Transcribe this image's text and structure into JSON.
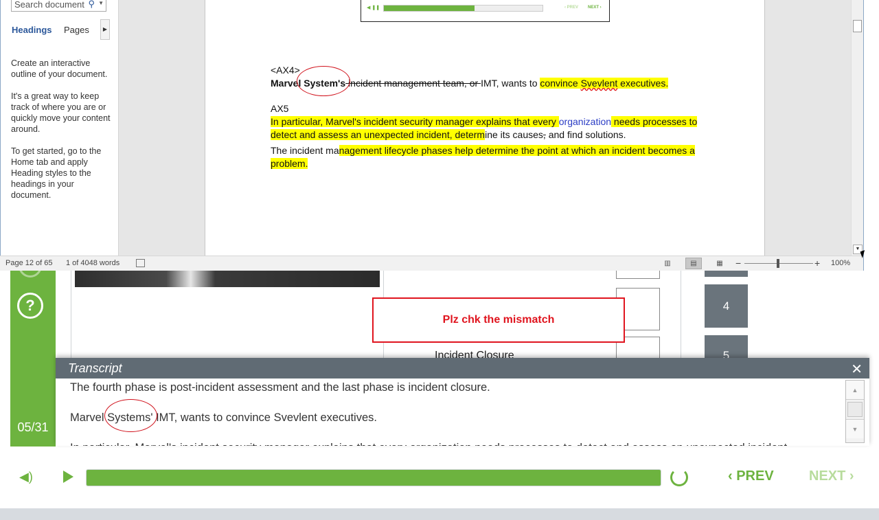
{
  "word": {
    "nav": {
      "search_placeholder": "Search document",
      "tab_headings": "Headings",
      "tab_pages": "Pages",
      "help_1": "Create an interactive outline of your document.",
      "help_2": "It's a great way to keep track of where you are or quickly move your content around.",
      "help_3": "To get started, go to the Home tab and apply Heading styles to the headings in your document."
    },
    "doc": {
      "ax4_tag": "<AX4>",
      "ax4_bold": "Marvel System's",
      "ax4_strike": " incident management team, or ",
      "ax4_rest": "IMT, wants to ",
      "ax4_hl_1": "convince ",
      "ax4_hl_word": "Svevlent",
      "ax4_hl_2": " executives.",
      "ax5_tag": "AX5",
      "ax5_hl_1": "In particular, Marvel's incident security manager explains that every ",
      "ax5_blue": "organization",
      "ax5_hl_2": " needs processes to detect and assess an unexpected incident, determ",
      "ax5_plain_1": "ine its causes",
      "ax5_strike": ",",
      "ax5_plain_2": " and find solutions.",
      "p3_plain": "The incident ma",
      "p3_hl": "nagement lifecycle phases help determine the point at which an incident becomes a problem."
    },
    "status": {
      "page": "Page 12 of 65",
      "words": "1 of 4048 words",
      "zoom": "100%"
    },
    "embed": {
      "prev": "‹ PREV",
      "next": "NEXT ›",
      "progress": 0.57
    }
  },
  "course": {
    "slide_counter": "05/31",
    "step_4": "4",
    "step_5": "5",
    "incident_closure": "Incident Closure",
    "callout": "Plz chk the mismatch",
    "transcript": {
      "title": "Transcript",
      "line_1": "The fourth phase is post-incident assessment and the last phase is incident closure.",
      "line_2": "Marvel Systems' IMT, wants to convince Svevlent executives.",
      "line_3": "In particular, Marvel's incident security manager explains that every organization needs processes to detect and assess an unexpected incident."
    },
    "controls": {
      "prev": "PREV",
      "next": "NEXT",
      "progress": 1.0
    }
  },
  "colors": {
    "accent": "#6db33f",
    "highlight": "#ffff00",
    "annotation": "#e0141e",
    "transcript_header": "#606b74"
  }
}
